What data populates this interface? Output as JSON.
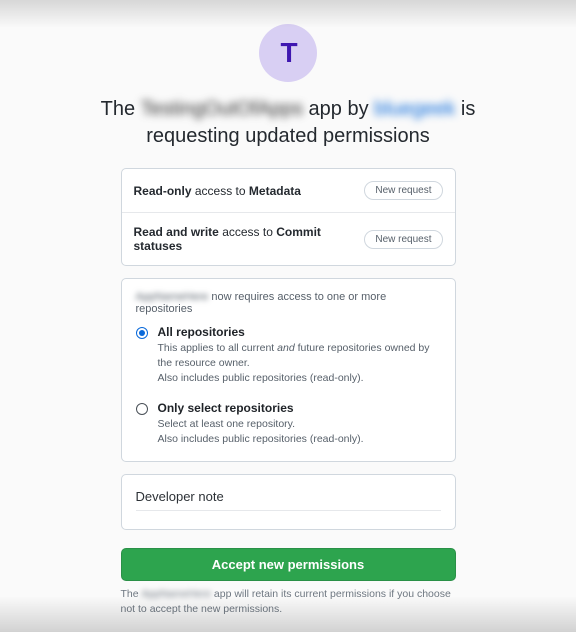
{
  "header": {
    "avatar_glyph": "T",
    "title_prefix": "The",
    "app_name_redacted": "TestingOutOfApps",
    "title_mid": "app by",
    "author_redacted": "bluegeek",
    "title_suffix": "is requesting updated permissions"
  },
  "permissions": [
    {
      "prefix": "Read-only",
      "mid": "access to",
      "target": "Metadata",
      "badge": "New request"
    },
    {
      "prefix": "Read and write",
      "mid": "access to",
      "target": "Commit statuses",
      "badge": "New request"
    }
  ],
  "repo_access": {
    "intro_redacted": "AppNameHere",
    "intro_suffix": "now requires access to one or more repositories",
    "options": [
      {
        "title": "All repositories",
        "desc_line1_a": "This applies to all current",
        "desc_line1_em": "and",
        "desc_line1_b": "future repositories owned by the resource owner.",
        "desc_line2": "Also includes public repositories (read-only).",
        "checked": true
      },
      {
        "title": "Only select repositories",
        "desc_line1": "Select at least one repository.",
        "desc_line2": "Also includes public repositories (read-only).",
        "checked": false
      }
    ]
  },
  "developer_note": {
    "label": "Developer note"
  },
  "actions": {
    "accept_label": "Accept new permissions"
  },
  "footer_note": {
    "prefix": "The",
    "app_redacted": "AppNameHere",
    "suffix": "app will retain its current permissions if you choose not to accept the new permissions."
  },
  "colors": {
    "accent_green": "#2da44e",
    "accent_blue": "#0969da",
    "avatar_bg": "#d8cff3",
    "avatar_fg": "#3f17b0"
  }
}
